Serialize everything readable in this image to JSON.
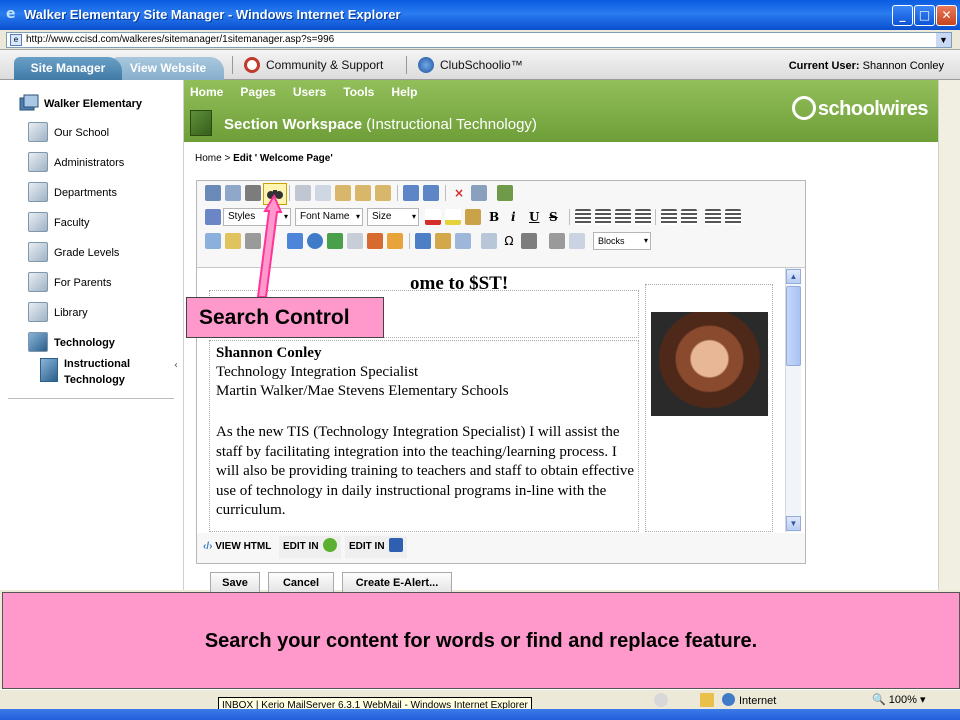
{
  "window": {
    "title": "Walker Elementary Site Manager - Windows Internet Explorer",
    "url": "http://www.ccisd.com/walkeres/sitemanager/1sitemanager.asp?s=996",
    "min_glyph": "_",
    "max_glyph": "□",
    "close_glyph": "✕"
  },
  "sitenav": {
    "tab_site_manager": "Site Manager",
    "tab_view_website": "View Website",
    "community": "Community & Support",
    "clubschoolio": "ClubSchoolio™",
    "current_user_label": "Current User:",
    "current_user_name": "Shannon Conley"
  },
  "sidebar": {
    "root": "Walker Elementary",
    "items": [
      {
        "label": "Our School"
      },
      {
        "label": "Administrators"
      },
      {
        "label": "Departments"
      },
      {
        "label": "Faculty"
      },
      {
        "label": "Grade Levels"
      },
      {
        "label": "For Parents"
      },
      {
        "label": "Library"
      },
      {
        "label": "Technology"
      }
    ],
    "sub_item": "Instructional Technology",
    "collapse_glyph": "‹"
  },
  "main": {
    "menu": [
      "Home",
      "Pages",
      "Users",
      "Tools",
      "Help"
    ],
    "logo": "schoolwires",
    "workspace_title": "Section Workspace",
    "workspace_sub": "(Instructional Technology)",
    "breadcrumb_home": "Home",
    "breadcrumb_sep": ">",
    "breadcrumb_current": "Edit ' Welcome Page'"
  },
  "editor": {
    "styles": "Styles",
    "font_name": "Font Name",
    "size": "Size",
    "blocks": "Blocks",
    "bold": "B",
    "italic": "i",
    "underline": "U",
    "strike": "S",
    "dd": "▾"
  },
  "content": {
    "welcome": "ome to $ST!",
    "name": "Shannon Conley",
    "line1": "Technology Integration Specialist",
    "line2": "Martin Walker/Mae Stevens Elementary Schools",
    "paragraph": "As the new TIS (Technology Integration Specialist) I will assist the staff by facilitating integration into the teaching/learning process. I will also be providing training to teachers and staff to obtain effective use of technology in daily instructional programs in-line with the curriculum."
  },
  "modes": {
    "view_html": "VIEW HTML",
    "edit_in_1": "EDIT IN",
    "edit_in_2": "EDIT IN"
  },
  "buttons": {
    "save": "Save",
    "cancel": "Cancel",
    "create_alert": "Create E-Alert..."
  },
  "callout": "Search Control",
  "caption": "Search your content for words or find and replace feature.",
  "status": {
    "zone": "Internet",
    "zoom": "100%",
    "tooltip": "INBOX | Kerio MailServer 6.3.1 WebMail - Windows Internet Explorer"
  },
  "colors": {
    "green_bar": "#7aa944",
    "callout": "#ff99cc",
    "callout_arrow": "#ff3399"
  }
}
